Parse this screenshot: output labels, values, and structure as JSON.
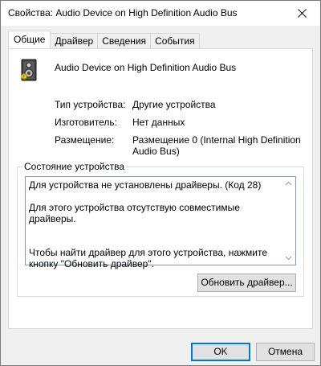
{
  "window": {
    "title": "Свойства: Audio Device on High Definition Audio Bus",
    "close_icon": "close-icon"
  },
  "tabs": [
    {
      "label": "Общие",
      "active": true
    },
    {
      "label": "Драйвер",
      "active": false
    },
    {
      "label": "Сведения",
      "active": false
    },
    {
      "label": "События",
      "active": false
    }
  ],
  "device": {
    "icon": "speaker-device-icon",
    "name": "Audio Device on High Definition Audio Bus"
  },
  "properties": [
    {
      "label": "Тип устройства:",
      "value": "Другие устройства"
    },
    {
      "label": "Изготовитель:",
      "value": "Нет данных"
    },
    {
      "label": "Размещение:",
      "value": "Размещение 0 (Internal High Definition Audio Bus)"
    }
  ],
  "status": {
    "title": "Состояние устройства",
    "text": "Для устройства не установлены драйверы. (Код 28)\n\nДля этого устройства отсутствую совместимые драйверы.\n\n\nЧтобы найти драйвер для этого устройства, нажмите кнопку \"Обновить драйвер\".",
    "update_button": "Обновить драйвер..."
  },
  "buttons": {
    "ok": "OK",
    "cancel": "Отмена"
  }
}
